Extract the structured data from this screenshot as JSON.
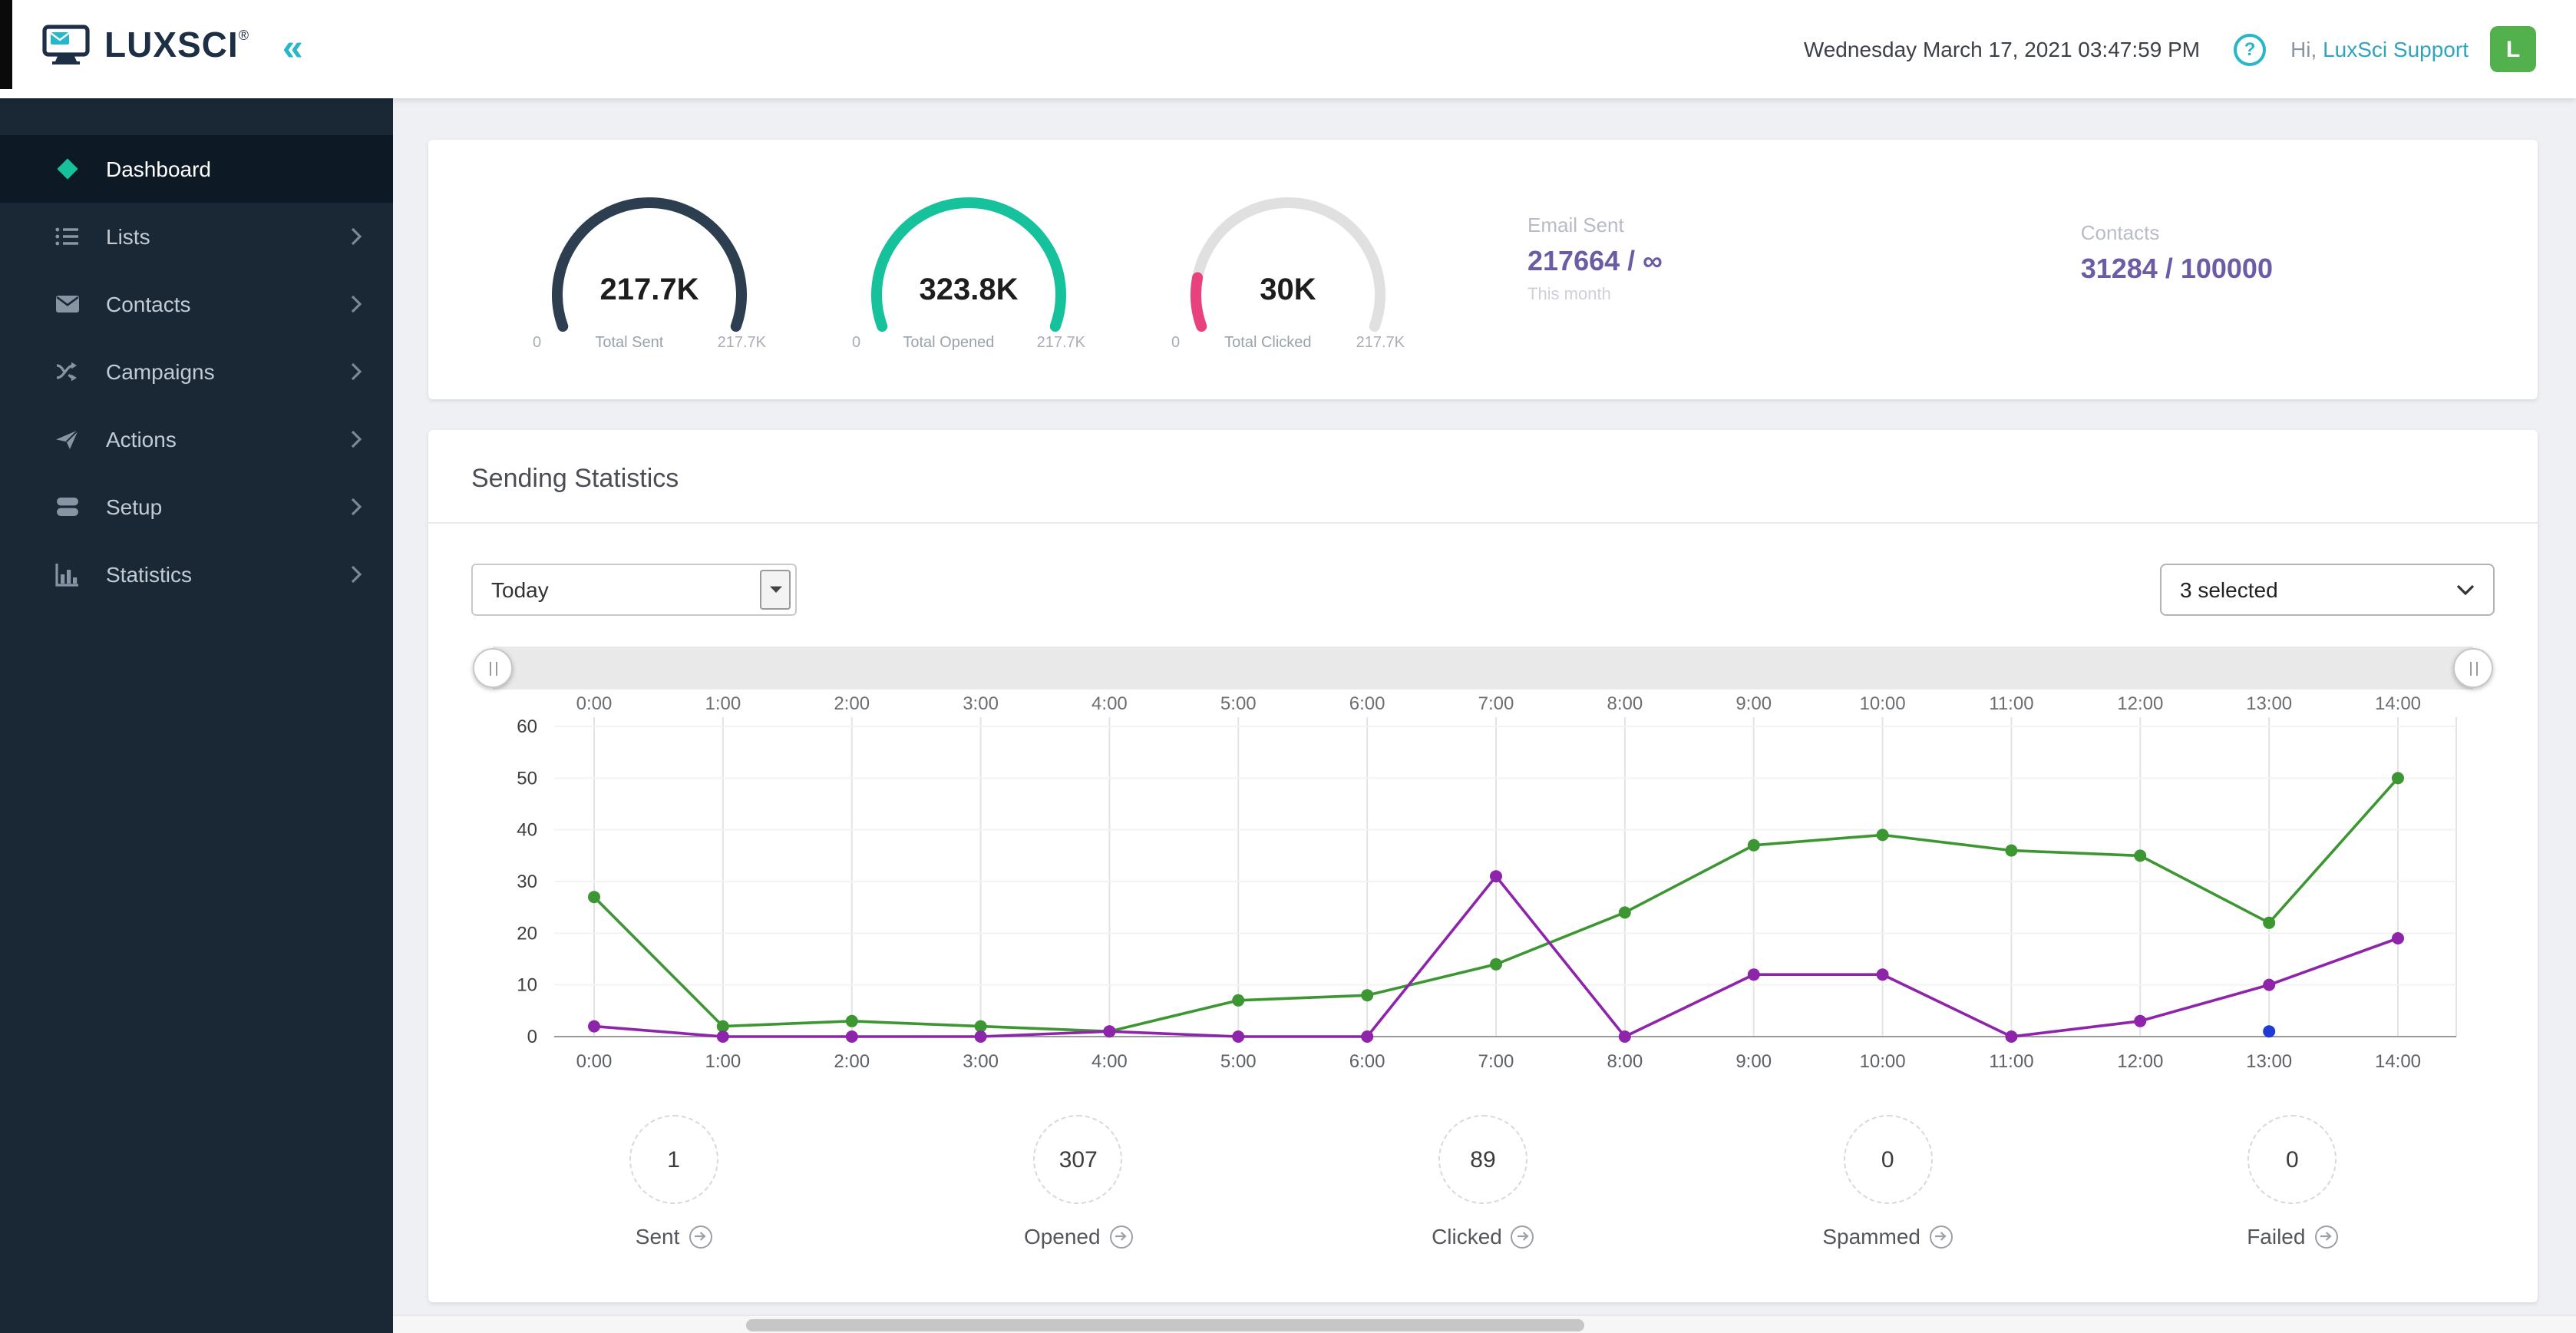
{
  "header": {
    "logo_text": "LUXSCI",
    "logo_reg": "®",
    "collapse_icon": "«",
    "datetime": "Wednesday March 17, 2021 03:47:59 PM",
    "help_glyph": "?",
    "greeting": "Hi,",
    "username": "LuxSci Support",
    "avatar_initial": "L"
  },
  "sidebar": {
    "items": [
      {
        "label": "Dashboard",
        "active": true
      },
      {
        "label": "Lists",
        "active": false
      },
      {
        "label": "Contacts",
        "active": false
      },
      {
        "label": "Campaigns",
        "active": false
      },
      {
        "label": "Actions",
        "active": false
      },
      {
        "label": "Setup",
        "active": false
      },
      {
        "label": "Statistics",
        "active": false
      }
    ]
  },
  "summary": {
    "gauges": [
      {
        "value": "217.7K",
        "label": "Total Sent",
        "min": "0",
        "max": "217.7K",
        "color": "#2c3e50",
        "track_color": "#e4e4e4",
        "fraction": 1
      },
      {
        "value": "323.8K",
        "label": "Total Opened",
        "min": "0",
        "max": "217.7K",
        "color": "#16c29b",
        "track_color": "#e4e4e4",
        "fraction": 1
      },
      {
        "value": "30K",
        "label": "Total Clicked",
        "min": "0",
        "max": "217.7K",
        "color": "#e8417e",
        "track_color": "#e0e0e0",
        "fraction": 0.14
      }
    ],
    "email_sent": {
      "label": "Email Sent",
      "value": "217664 / ∞",
      "period": "This month"
    },
    "contacts": {
      "label": "Contacts",
      "value": "31284 / 100000"
    }
  },
  "stats_panel": {
    "title": "Sending Statistics",
    "period_filter_value": "Today",
    "series_filter_value": "3 selected",
    "chart_data": {
      "type": "line",
      "x": [
        "0:00",
        "1:00",
        "2:00",
        "3:00",
        "4:00",
        "5:00",
        "6:00",
        "7:00",
        "8:00",
        "9:00",
        "10:00",
        "11:00",
        "12:00",
        "13:00",
        "14:00"
      ],
      "series": [
        {
          "name": "green-series",
          "color": "#3c9632",
          "values": [
            27,
            2,
            3,
            2,
            1,
            7,
            8,
            14,
            24,
            37,
            39,
            36,
            35,
            22,
            50
          ]
        },
        {
          "name": "purple-series",
          "color": "#8e24aa",
          "values": [
            2,
            0,
            0,
            0,
            1,
            0,
            0,
            31,
            0,
            12,
            12,
            0,
            3,
            10,
            19
          ]
        },
        {
          "name": "blue-series",
          "color": "#1f3bd3",
          "values": [
            null,
            null,
            null,
            null,
            null,
            null,
            null,
            null,
            null,
            null,
            null,
            null,
            null,
            1,
            null
          ]
        }
      ],
      "ylim": [
        0,
        60
      ],
      "yticks": [
        0,
        10,
        20,
        30,
        40,
        50,
        60
      ],
      "grid": true,
      "legend": "none"
    },
    "badges": [
      {
        "value": "1",
        "label": "Sent"
      },
      {
        "value": "307",
        "label": "Opened"
      },
      {
        "value": "89",
        "label": "Clicked"
      },
      {
        "value": "0",
        "label": "Spammed"
      },
      {
        "value": "0",
        "label": "Failed"
      }
    ]
  }
}
